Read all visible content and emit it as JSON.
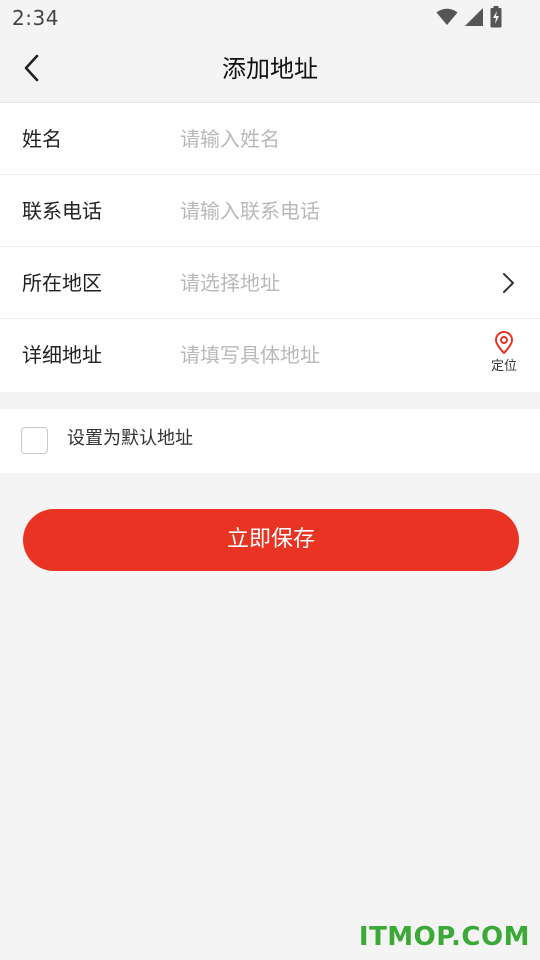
{
  "status_bar": {
    "time": "2:34",
    "icons": [
      "wifi-icon",
      "signal-icon",
      "battery-charging-icon"
    ]
  },
  "header": {
    "back_icon": "chevron-left-icon",
    "title": "添加地址"
  },
  "form": {
    "name": {
      "label": "姓名",
      "placeholder": "请输入姓名",
      "value": ""
    },
    "phone": {
      "label": "联系电话",
      "placeholder": "请输入联系电话",
      "value": ""
    },
    "region": {
      "label": "所在地区",
      "placeholder": "请选择地址",
      "icon": "chevron-right-icon"
    },
    "detail": {
      "label": "详细地址",
      "placeholder": "请填写具体地址",
      "value": "",
      "locate_label": "定位",
      "locate_icon": "location-pin-icon"
    }
  },
  "default_address": {
    "label": "设置为默认地址",
    "checked": false
  },
  "actions": {
    "save_label": "立即保存"
  },
  "watermark": "ITMOP.COM",
  "colors": {
    "accent": "#ea3423",
    "background": "#f4f4f4",
    "placeholder": "#b9b9b9",
    "watermark": "#3aa935"
  }
}
